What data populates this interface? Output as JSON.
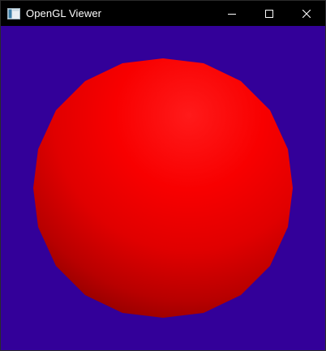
{
  "window": {
    "title": "OpenGL Viewer",
    "app_icon": "application-window-icon",
    "controls": {
      "minimize_icon": "minimize-icon",
      "maximize_icon": "maximize-icon",
      "close_icon": "close-icon"
    }
  },
  "viewport": {
    "background_color": "#330099",
    "object": {
      "shape": "sphere",
      "base_color": "#ff0000",
      "highlight_color": "#ff1a1a",
      "shadow_color": "#7a0000"
    }
  },
  "colors": {
    "titlebar_bg": "#000000",
    "titlebar_fg": "#ffffff"
  }
}
